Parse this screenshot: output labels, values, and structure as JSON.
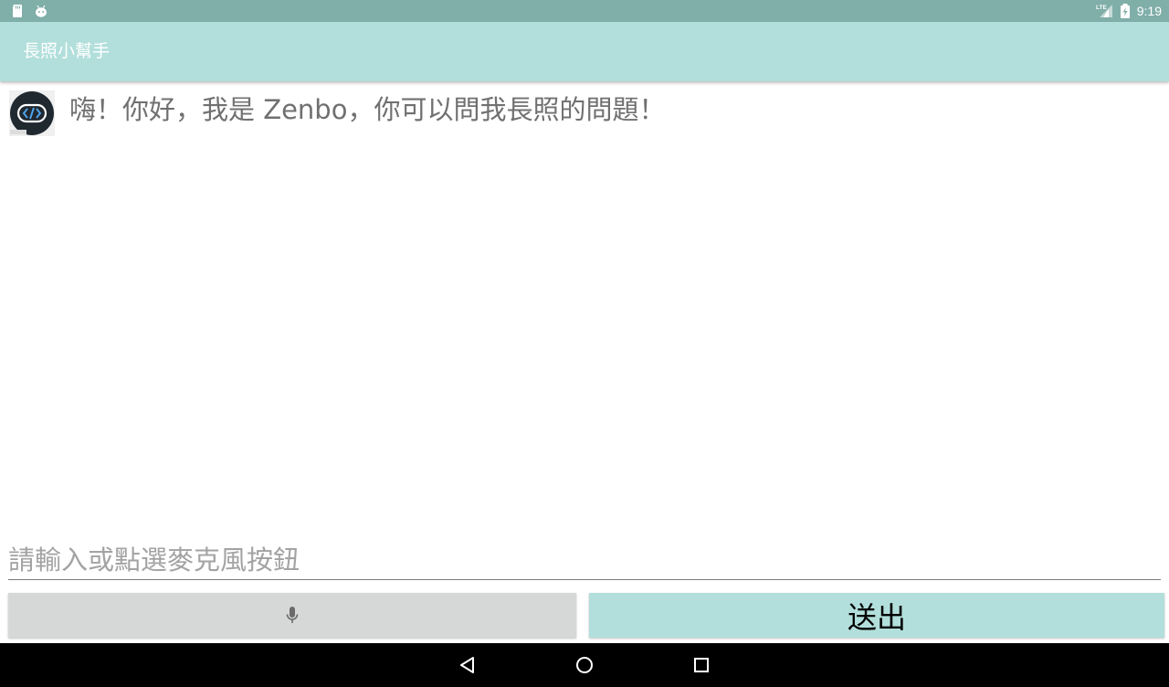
{
  "status_bar": {
    "left_icons": [
      "sd-card-icon",
      "android-debug-icon"
    ],
    "right_icons": [
      "lte-signal-icon",
      "battery-charging-icon"
    ],
    "network_label": "LTE",
    "time": "9:19"
  },
  "app_bar": {
    "title": "長照小幫手"
  },
  "chat": {
    "messages": [
      {
        "avatar": "zenbo-code-logo",
        "text": "嗨！你好，我是 Zenbo，你可以問我長照的問題！"
      }
    ]
  },
  "composer": {
    "input_placeholder": "請輸入或點選麥克風按鈕",
    "input_value": "",
    "mic_icon": "microphone-icon",
    "send_label": "送出"
  },
  "nav_bar": {
    "icons": [
      "back-icon",
      "home-icon",
      "recents-icon"
    ]
  },
  "colors": {
    "status_bar": "#80aea9",
    "app_bar": "#b2dfdb",
    "send_button": "#b2dfdb",
    "mic_button": "#d6d7d7",
    "message_text": "#707070",
    "placeholder": "#a3a3a3"
  }
}
